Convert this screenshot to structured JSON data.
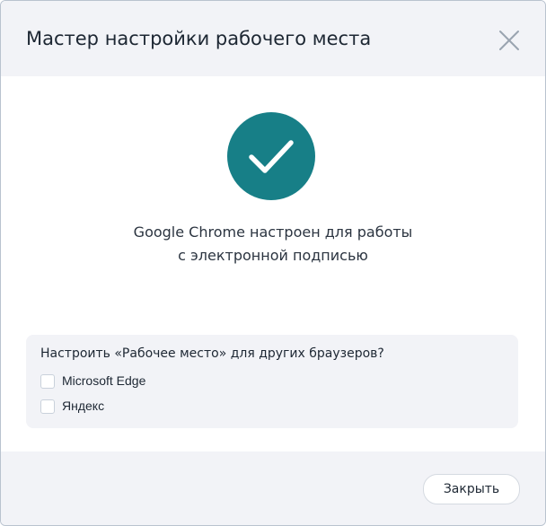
{
  "dialog": {
    "title": "Мастер настройки рабочего места",
    "close_icon": "close-icon"
  },
  "status": {
    "icon": "checkmark-icon",
    "icon_color": "#177f87",
    "line1": "Google Chrome настроен для работы",
    "line2": "с электронной подписью"
  },
  "browsers": {
    "question": "Настроить «Рабочее место» для других браузеров?",
    "options": [
      {
        "label": "Microsoft Edge",
        "checked": false
      },
      {
        "label": "Яндекс",
        "checked": false
      }
    ]
  },
  "footer": {
    "close_label": "Закрыть"
  }
}
